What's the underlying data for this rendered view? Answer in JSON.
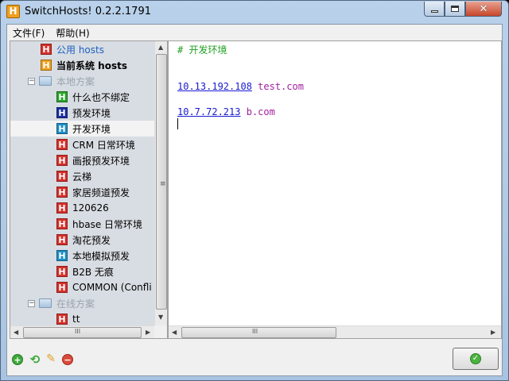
{
  "window": {
    "title": "SwitchHosts! 0.2.2.1791",
    "app_icon_letter": "H"
  },
  "menu": {
    "items": [
      "文件(F)",
      "帮助(H)"
    ]
  },
  "tree": {
    "items": [
      {
        "label": "公用 hosts",
        "icon_letter": "H",
        "icon_color": "#d8302a"
      },
      {
        "label": "当前系统 hosts",
        "icon_letter": "H",
        "icon_color": "#f0a020"
      },
      {
        "label": "本地方案",
        "expander": "−"
      },
      {
        "label": "什么也不绑定",
        "icon_letter": "H",
        "icon_color": "#2aa52a"
      },
      {
        "label": "预发环境",
        "icon_letter": "H",
        "icon_color": "#1a2fa0"
      },
      {
        "label": "开发环境",
        "icon_letter": "H",
        "icon_color": "#1f8fc6"
      },
      {
        "label": "CRM 日常环境",
        "icon_letter": "H",
        "icon_color": "#d8302a"
      },
      {
        "label": "画报预发环境",
        "icon_letter": "H",
        "icon_color": "#d8302a"
      },
      {
        "label": "云梯",
        "icon_letter": "H",
        "icon_color": "#d8302a"
      },
      {
        "label": "家居频道预发",
        "icon_letter": "H",
        "icon_color": "#d8302a"
      },
      {
        "label": "120626",
        "icon_letter": "H",
        "icon_color": "#d8302a"
      },
      {
        "label": "hbase 日常环境",
        "icon_letter": "H",
        "icon_color": "#d8302a"
      },
      {
        "label": "淘花预发",
        "icon_letter": "H",
        "icon_color": "#d8302a"
      },
      {
        "label": "本地模拟预发",
        "icon_letter": "H",
        "icon_color": "#1f8fc6"
      },
      {
        "label": "B2B 无痕",
        "icon_letter": "H",
        "icon_color": "#d8302a"
      },
      {
        "label": "COMMON (Confli",
        "icon_letter": "H",
        "icon_color": "#d8302a"
      },
      {
        "label": "在线方案",
        "expander": "−"
      },
      {
        "label": "tt",
        "icon_letter": "H",
        "icon_color": "#d8302a"
      }
    ],
    "scroll_grip": "≡",
    "hscroll_grip": "III"
  },
  "editor": {
    "comment": "# 开发环境",
    "entries": [
      {
        "ip": "10.13.192.108",
        "host": "test.com"
      },
      {
        "ip": "10.7.72.213",
        "host": "b.com"
      }
    ],
    "hscroll_grip": "III"
  },
  "toolbar": {
    "add_glyph": "+",
    "refresh_glyph": "⟲",
    "edit_glyph": "✎",
    "delete_glyph": "−",
    "apply_glyph": "✓"
  },
  "colors": {
    "comment": "#20a020",
    "ip": "#1a1ad0",
    "host": "#a020a0",
    "selected_row": "#f3f3f3"
  }
}
